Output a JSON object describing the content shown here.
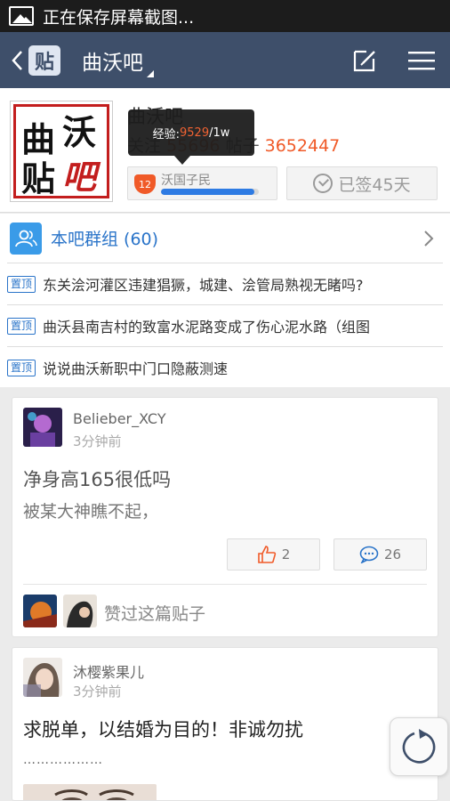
{
  "status_bar": {
    "text": "正在保存屏幕截图..."
  },
  "nav": {
    "logo_char": "贴",
    "title": "曲沃吧"
  },
  "forum": {
    "name": "曲沃吧",
    "followers_label": "关注",
    "followers": "55696",
    "posts_label": "帖子",
    "posts": "3652447",
    "avatar_chars": [
      "曲",
      "沃",
      "贴",
      "吧"
    ],
    "level": {
      "number": "12",
      "name": "沃国子民",
      "progress": 0.95
    },
    "tooltip": {
      "label": "经验: ",
      "exp": "9529",
      "max": "/1w"
    },
    "signin": "已签45天"
  },
  "group": {
    "label": "本吧群组 (60)"
  },
  "pinned": {
    "tag": "置顶",
    "items": [
      "东关浍河灌区违建猖獗，城建、浍管局熟视无睹吗?",
      "曲沃县南吉村的致富水泥路变成了伤心泥水路（组图",
      "说说曲沃新职中门口隐蔽测速"
    ]
  },
  "posts": [
    {
      "user": "Belieber_XCY",
      "time": "3分钟前",
      "title": "净身高165很低吗",
      "body": "被某大神瞧不起，",
      "likes": "2",
      "comments": "26",
      "liked_text": "赞过这篇贴子"
    },
    {
      "user": "沐樱紫果儿",
      "time": "3分钟前",
      "title": "求脱单，以结婚为目的！非诚勿扰",
      "dots": "………………"
    }
  ],
  "colors": {
    "nav_bg": "#3e4f6a",
    "accent": "#2a74c9",
    "orange": "#f05a28"
  }
}
